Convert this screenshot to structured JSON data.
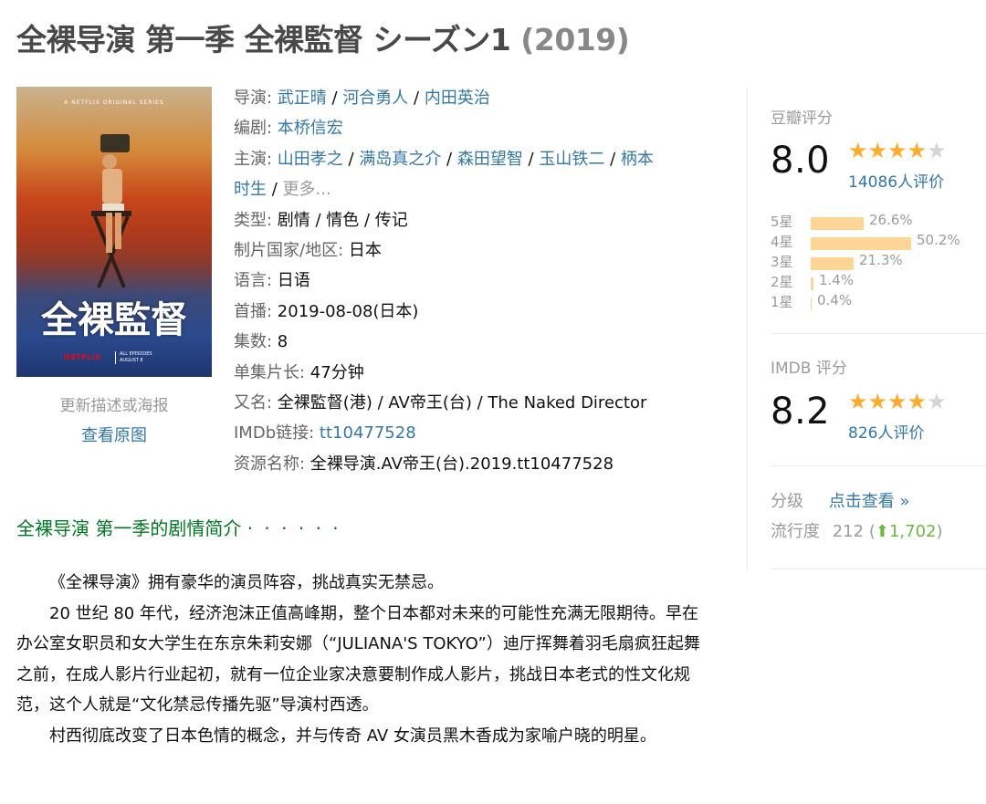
{
  "title": {
    "main": "全裸导演 第一季 全裸監督 シーズン1",
    "year": "(2019)"
  },
  "poster": {
    "series_text": "A NETFLIX ORIGINAL SERIES",
    "big_title": "全裸監督",
    "brand": "NETFLIX",
    "episodes_note": "ALL EPISODES AUGUST 8",
    "update_link": "更新描述或海报",
    "view_link": "查看原图"
  },
  "info": {
    "director_label": "导演",
    "directors": [
      "武正晴",
      "河合勇人",
      "内田英治"
    ],
    "writer_label": "编剧",
    "writers": [
      "本桥信宏"
    ],
    "cast_label": "主演",
    "cast": [
      "山田孝之",
      "满岛真之介",
      "森田望智",
      "玉山铁二",
      "柄本时生"
    ],
    "cast_line1_last": "柄本",
    "cast_line2_first": "时生",
    "more": "更多...",
    "genre_label": "类型",
    "genre": "剧情 / 情色 / 传记",
    "country_label": "制片国家/地区",
    "country": "日本",
    "language_label": "语言",
    "language": "日语",
    "premiere_label": "首播",
    "premiere": "2019-08-08(日本)",
    "episodes_label": "集数",
    "episodes": "8",
    "runtime_label": "单集片长",
    "runtime": "47分钟",
    "aka_label": "又名",
    "aka": "全裸監督(港) / AV帝王(台) / The Naked Director",
    "imdb_label": "IMDb链接",
    "imdb_id": "tt10477528",
    "resource_label": "资源名称",
    "resource": "全裸导演.AV帝王(台).2019.tt10477528"
  },
  "douban": {
    "label": "豆瓣评分",
    "score": "8.0",
    "stars": 4,
    "votes": "14086人评价",
    "distribution": [
      {
        "label": "5星",
        "pct": "26.6%",
        "value": 26.6
      },
      {
        "label": "4星",
        "pct": "50.2%",
        "value": 50.2
      },
      {
        "label": "3星",
        "pct": "21.3%",
        "value": 21.3
      },
      {
        "label": "2星",
        "pct": "1.4%",
        "value": 1.4
      },
      {
        "label": "1星",
        "pct": "0.4%",
        "value": 0.4
      }
    ],
    "bar_color": "#ffd596",
    "star_color": "#ffac2d"
  },
  "imdb": {
    "label": "IMDB 评分",
    "score": "8.2",
    "stars": 4,
    "votes": "826人评价"
  },
  "meta": {
    "rating_label": "分级",
    "rating_link": "点击查看 »",
    "popularity_label": "流行度",
    "popularity": "212",
    "popularity_change": "1,702",
    "up_color": "#6aba3f"
  },
  "summary": {
    "heading": "全裸导演 第一季的剧情简介",
    "heading_dots": "· · · · · ·",
    "paragraphs": [
      "《全裸导演》拥有豪华的演员阵容，挑战真实无禁忌。",
      "20 世纪 80 年代，经济泡沫正值高峰期，整个日本都对未来的可能性充满无限期待。早在办公室女职员和女大学生在东京朱莉安娜（“JULIANA'S TOKYO”）迪厅挥舞着羽毛扇疯狂起舞之前，在成人影片行业起初，就有一位企业家决意要制作成人影片，挑战日本老式的性文化规范，这个人就是“文化禁忌传播先驱”导演村西透。",
      "村西彻底改变了日本色情的概念，并与传奇 AV 女演员黑木香成为家喻户晓的明星。"
    ]
  }
}
